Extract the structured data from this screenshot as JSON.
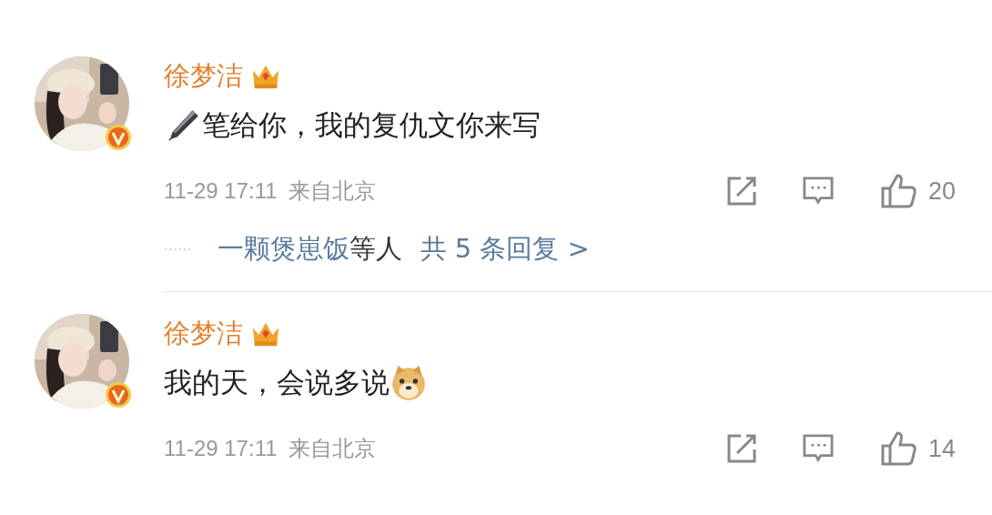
{
  "comments": [
    {
      "author": "徐梦洁",
      "content": [
        {
          "kind": "pen"
        },
        {
          "kind": "text",
          "text": "笔给你，我的复仇文你来写"
        }
      ],
      "time": "11-29 17:11",
      "location": "来自北京",
      "likes": "20",
      "replies": {
        "dots": "······",
        "names": "一颗煲崽饭",
        "suffix": "等人",
        "count": "共 5 条回复 >"
      }
    },
    {
      "author": "徐梦洁",
      "content": [
        {
          "kind": "text",
          "text": "我的天，会说多说"
        },
        {
          "kind": "dog"
        }
      ],
      "time": "11-29 17:11",
      "location": "来自北京",
      "likes": "14"
    }
  ]
}
